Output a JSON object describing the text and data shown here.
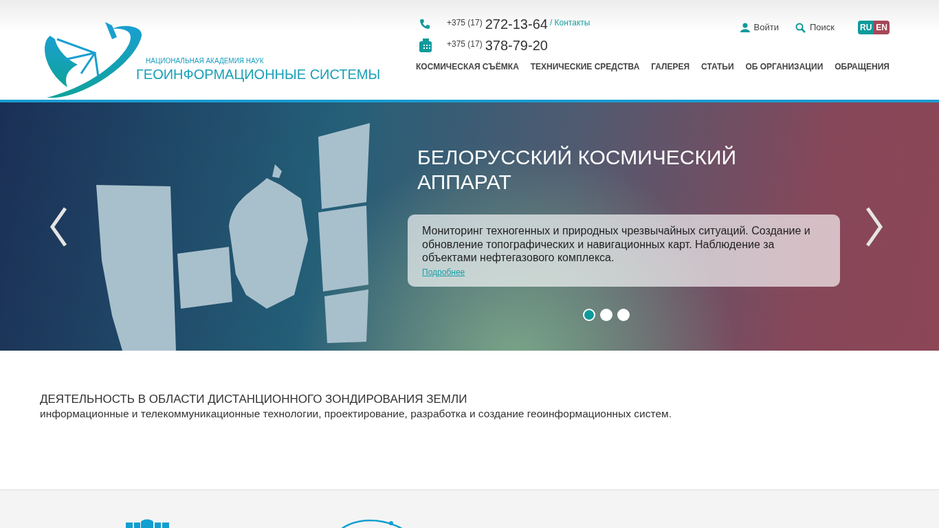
{
  "header": {
    "org_subtitle": "НАЦИОНАЛЬНАЯ АКАДЕМИЯ НАУК",
    "org_title": "ГЕОИНФОРМАЦИОННЫЕ СИСТЕМЫ",
    "phones": [
      {
        "kind": "phone",
        "prefix": "+375 (17)",
        "number": "272-13-64"
      },
      {
        "kind": "fax",
        "prefix": "+375 (17)",
        "number": "378-79-20"
      }
    ],
    "contacts_link": "/ Контакты",
    "login": "Войти",
    "search": "Поиск",
    "languages": [
      {
        "label": "RU",
        "selected": true
      },
      {
        "label": "EN",
        "selected": false
      }
    ],
    "nav": [
      "КОСМИЧЕСКАЯ СЪЁМКА",
      "ТЕХНИЧЕСКИЕ СРЕДСТВА",
      "ГАЛЕРЕЯ",
      "СТАТЬИ",
      "ОБ ОРГАНИЗАЦИИ",
      "ОБРАЩЕНИЯ"
    ]
  },
  "slider": {
    "title": "БЕЛОРУССКИЙ КОСМИЧЕСКИЙ АППАРАТ",
    "caption": "Мониторинг техногенных и природных чрезвычайных ситуаций. Создание и обновление топографических и навигационных карт. Наблюдение за объектами нефтегазового комплекса.",
    "more_link": "Подробнее",
    "dots": [
      {
        "selected": true
      },
      {
        "selected": false
      },
      {
        "selected": false
      }
    ]
  },
  "intro": {
    "heading": "ДЕЯТЕЛЬНОСТЬ В ОБЛАСТИ ДИСТАНЦИОННОГО ЗОНДИРОВАНИЯ ЗЕМЛИ",
    "text": "информационные и телекоммуникационные технологии, проектирование, разработка и создание геоинформационных систем."
  }
}
